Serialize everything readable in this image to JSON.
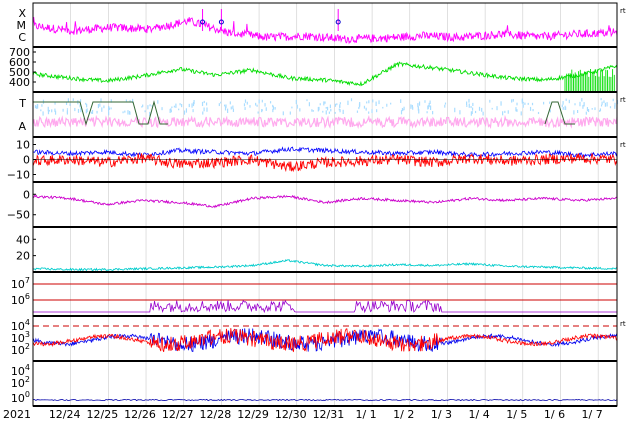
{
  "chart_data": {
    "type": "line",
    "x_labels": [
      "2021",
      "12/24",
      "12/25",
      "12/26",
      "12/27",
      "12/28",
      "12/29",
      "12/30",
      "12/31",
      "1/ 1",
      "1/ 2",
      "1/ 3",
      "1/ 4",
      "1/ 5",
      "1/ 6",
      "1/ 7"
    ],
    "panels": [
      {
        "id": "xmc",
        "label_lines": [
          "X",
          "M",
          "C"
        ],
        "unit": "rt",
        "series": [
          {
            "color": "#ff00ff",
            "level": [
              0.55,
              0.4,
              0.5,
              0.45,
              0.7,
              0.35,
              0.2,
              0.25,
              0.15,
              0.18,
              0.25,
              0.2,
              0.3,
              0.22,
              0.3,
              0.35
            ]
          }
        ],
        "event_markers": [
          4.5,
          5.0,
          8.1
        ]
      },
      {
        "id": "speed",
        "yticks": [
          "700",
          "600",
          "500",
          "400"
        ],
        "ylim": [
          300,
          750
        ],
        "series": [
          {
            "color": "#00dd00",
            "values": [
              480,
              440,
              410,
              460,
              530,
              470,
              520,
              440,
              420,
              380,
              580,
              540,
              490,
              440,
              420,
              470,
              560
            ]
          }
        ]
      },
      {
        "id": "ta",
        "label_lines": [
          "T",
          "A"
        ],
        "unit": "rt",
        "series": [
          {
            "color": "#aaddff",
            "name": "T"
          },
          {
            "color": "#ffaaee",
            "name": "A"
          },
          {
            "color": "#336633",
            "name": "gate"
          }
        ]
      },
      {
        "id": "bfield",
        "yticks": [
          "10",
          "0",
          "−10"
        ],
        "ylim": [
          -15,
          15
        ],
        "unit": "rt",
        "series": [
          {
            "color": "#0000ff",
            "values": [
              5,
              4,
              5,
              3,
              6,
              5,
              4,
              7,
              6,
              5,
              4,
              5,
              3,
              4,
              5,
              3,
              4
            ]
          },
          {
            "color": "#ff0000",
            "values": [
              -1,
              0,
              -2,
              1,
              -3,
              -2,
              0,
              -5,
              -2,
              -1,
              0,
              -2,
              1,
              -1,
              0,
              1,
              0
            ]
          }
        ]
      },
      {
        "id": "angle",
        "yticks": [
          "0",
          "−50"
        ],
        "ylim": [
          -80,
          30
        ],
        "series": [
          {
            "color": "#cc00cc",
            "values": [
              -5,
              -10,
              -25,
              -15,
              -20,
              -30,
              -10,
              -5,
              -20,
              -10,
              -15,
              -20,
              -10,
              -15,
              -10,
              -15,
              -10
            ]
          }
        ]
      },
      {
        "id": "density",
        "yticks": [
          "40",
          "20"
        ],
        "ylim": [
          0,
          55
        ],
        "series": [
          {
            "color": "#00cccc",
            "values": [
              4,
              3,
              3,
              4,
              5,
              6,
              8,
              14,
              8,
              7,
              9,
              8,
              10,
              7,
              6,
              5,
              4
            ]
          }
        ]
      },
      {
        "id": "proton",
        "yticks": [
          "10^7",
          "10^6"
        ],
        "series": [
          {
            "color": "#9900cc",
            "name": "purple"
          }
        ],
        "ref_lines_color": "#cc0000"
      },
      {
        "id": "electron",
        "yticks": [
          "10^4",
          "10^3",
          "10^2"
        ],
        "unit": "rt",
        "series": [
          {
            "color": "#0000ee",
            "name": "blue"
          },
          {
            "color": "#ff0000",
            "name": "red"
          }
        ],
        "ref_line_color": "#cc0000"
      },
      {
        "id": "bottom",
        "yticks": [
          "10^4",
          "10^2",
          "10^0"
        ],
        "series": [
          {
            "color": "#0000aa",
            "name": "baseline"
          }
        ]
      }
    ]
  }
}
